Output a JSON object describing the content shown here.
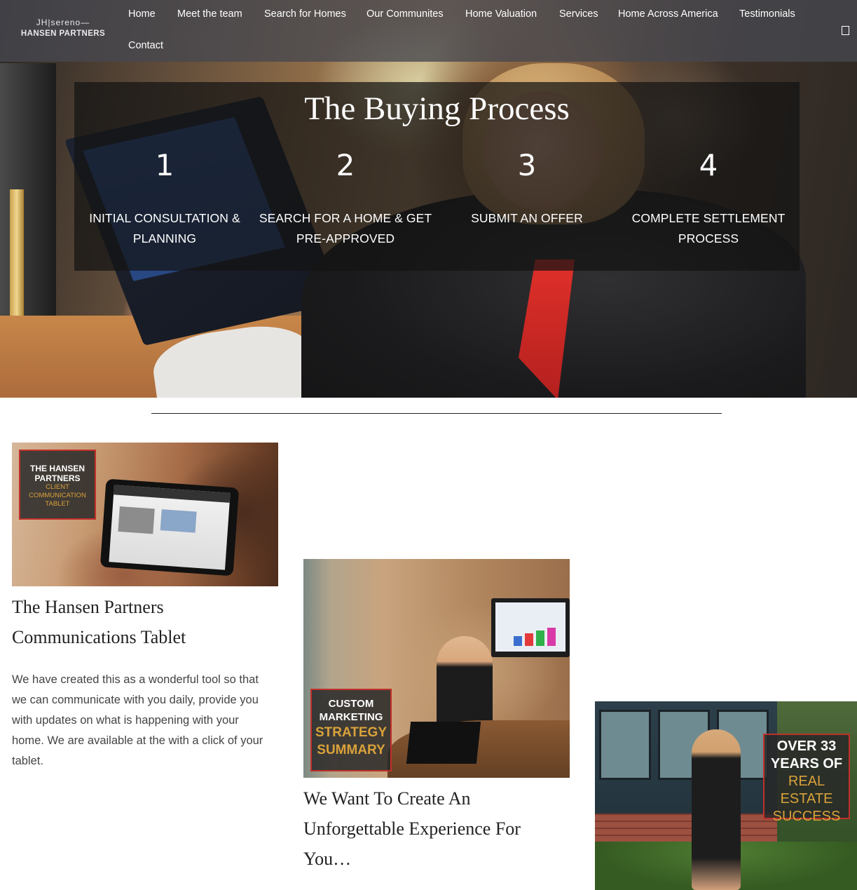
{
  "brand": {
    "logo_top": "JH|sereno—",
    "logo_bottom": "HANSEN PARTNERS"
  },
  "nav": {
    "items": [
      "Home",
      "Meet the team",
      "Search for Homes",
      "Our Communites",
      "Home Valuation",
      "Services",
      "Home Across America",
      "Testimonials",
      "Contact"
    ],
    "menu_toggle_icon": "menu-square-icon"
  },
  "process": {
    "title": "The Buying Process",
    "steps": [
      {
        "number": "1",
        "label_line1": "INITIAL CONSULTATION &",
        "label_line2": "PLANNING"
      },
      {
        "number": "2",
        "label_line1": "SEARCH FOR A HOME & GET",
        "label_line2": "PRE-APPROVED"
      },
      {
        "number": "3",
        "label_line1": "SUBMIT AN OFFER",
        "label_line2": ""
      },
      {
        "number": "4",
        "label_line1": "COMPLETE SETTLEMENT",
        "label_line2": "PROCESS"
      }
    ]
  },
  "cards": [
    {
      "image_overlay": {
        "line1": "THE HANSEN",
        "line2": "PARTNERS",
        "line3": "CLIENT COMMUNICATION",
        "line4": "TABLET"
      },
      "title_line1": "The Hansen Partners",
      "title_line2": "Communications Tablet",
      "text_lines": [
        "We have created this as a wonderful tool so that",
        "we can communicate with you daily, provide you",
        "with updates on what is happening with your",
        "home. We are available at the with a click of your",
        "tablet."
      ]
    },
    {
      "image_overlay": {
        "line1": "CUSTOM",
        "line2": "MARKETING",
        "line3": "STRATEGY",
        "line4": "SUMMARY"
      },
      "title_line1": "We Want To Create An",
      "title_line2": "Unforgettable Experience For",
      "title_line3": "You…"
    },
    {
      "image_overlay": {
        "line1": "OVER 33",
        "line2": "YEARS OF",
        "line3": "REAL ESTATE",
        "line4": "SUCCESS"
      }
    }
  ],
  "colors": {
    "overlay_red_border": "#c0302a",
    "overlay_gold": "#d9a23a",
    "nav_bg": "#464850"
  }
}
